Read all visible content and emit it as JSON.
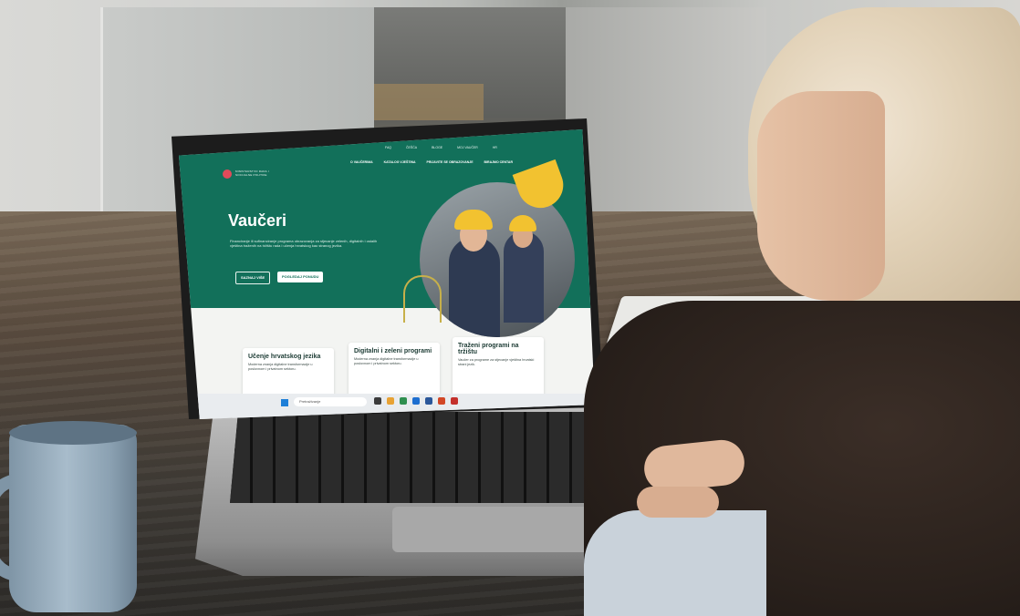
{
  "site": {
    "logo_text": "MINISTARSTVO RADA I SOCIJALNE POLITIKE",
    "utility_nav": [
      "FAQ",
      "ČEŠĆA",
      "BLOGE",
      "MOJ VAUČER",
      "HR"
    ],
    "main_nav": [
      "O VAUČERIMA",
      "KATALOG VJEŠTINA",
      "PRIJAVITE SE OBRAZOVANJE",
      "BIRAJMO CENTAR"
    ],
    "hero": {
      "title": "Vaučeri",
      "lead": "Financiranje ili sufinanciranje programa obrazovanja za stjecanje zelenih, digitalnih i ostalih vještina traženih na tržištu rada i učenja hrvatskog kao stranog jezika.",
      "button_primary": "SAZNAJ VIŠE",
      "button_secondary": "POGLEDAJ PONUDU"
    },
    "cards": [
      {
        "title": "Učenje hrvatskog jezika",
        "text": "Moderna znanja digitalne transformacije u poslovnom i privatnom sektoru."
      },
      {
        "title": "Digitalni i zeleni programi",
        "text": "Moderna znanja digitalne transformacije u poslovnom i privatnom sektoru."
      },
      {
        "title": "Traženi programi na tržištu",
        "text": "Vaučer za programe za stjecanje vještina hrvatski strani jezik."
      }
    ],
    "taskbar": {
      "search_placeholder": "Pretraživanje"
    }
  },
  "colors": {
    "brand_green": "#12705a",
    "accent_yellow": "#f2c230",
    "logo_red": "#e14a5a"
  }
}
